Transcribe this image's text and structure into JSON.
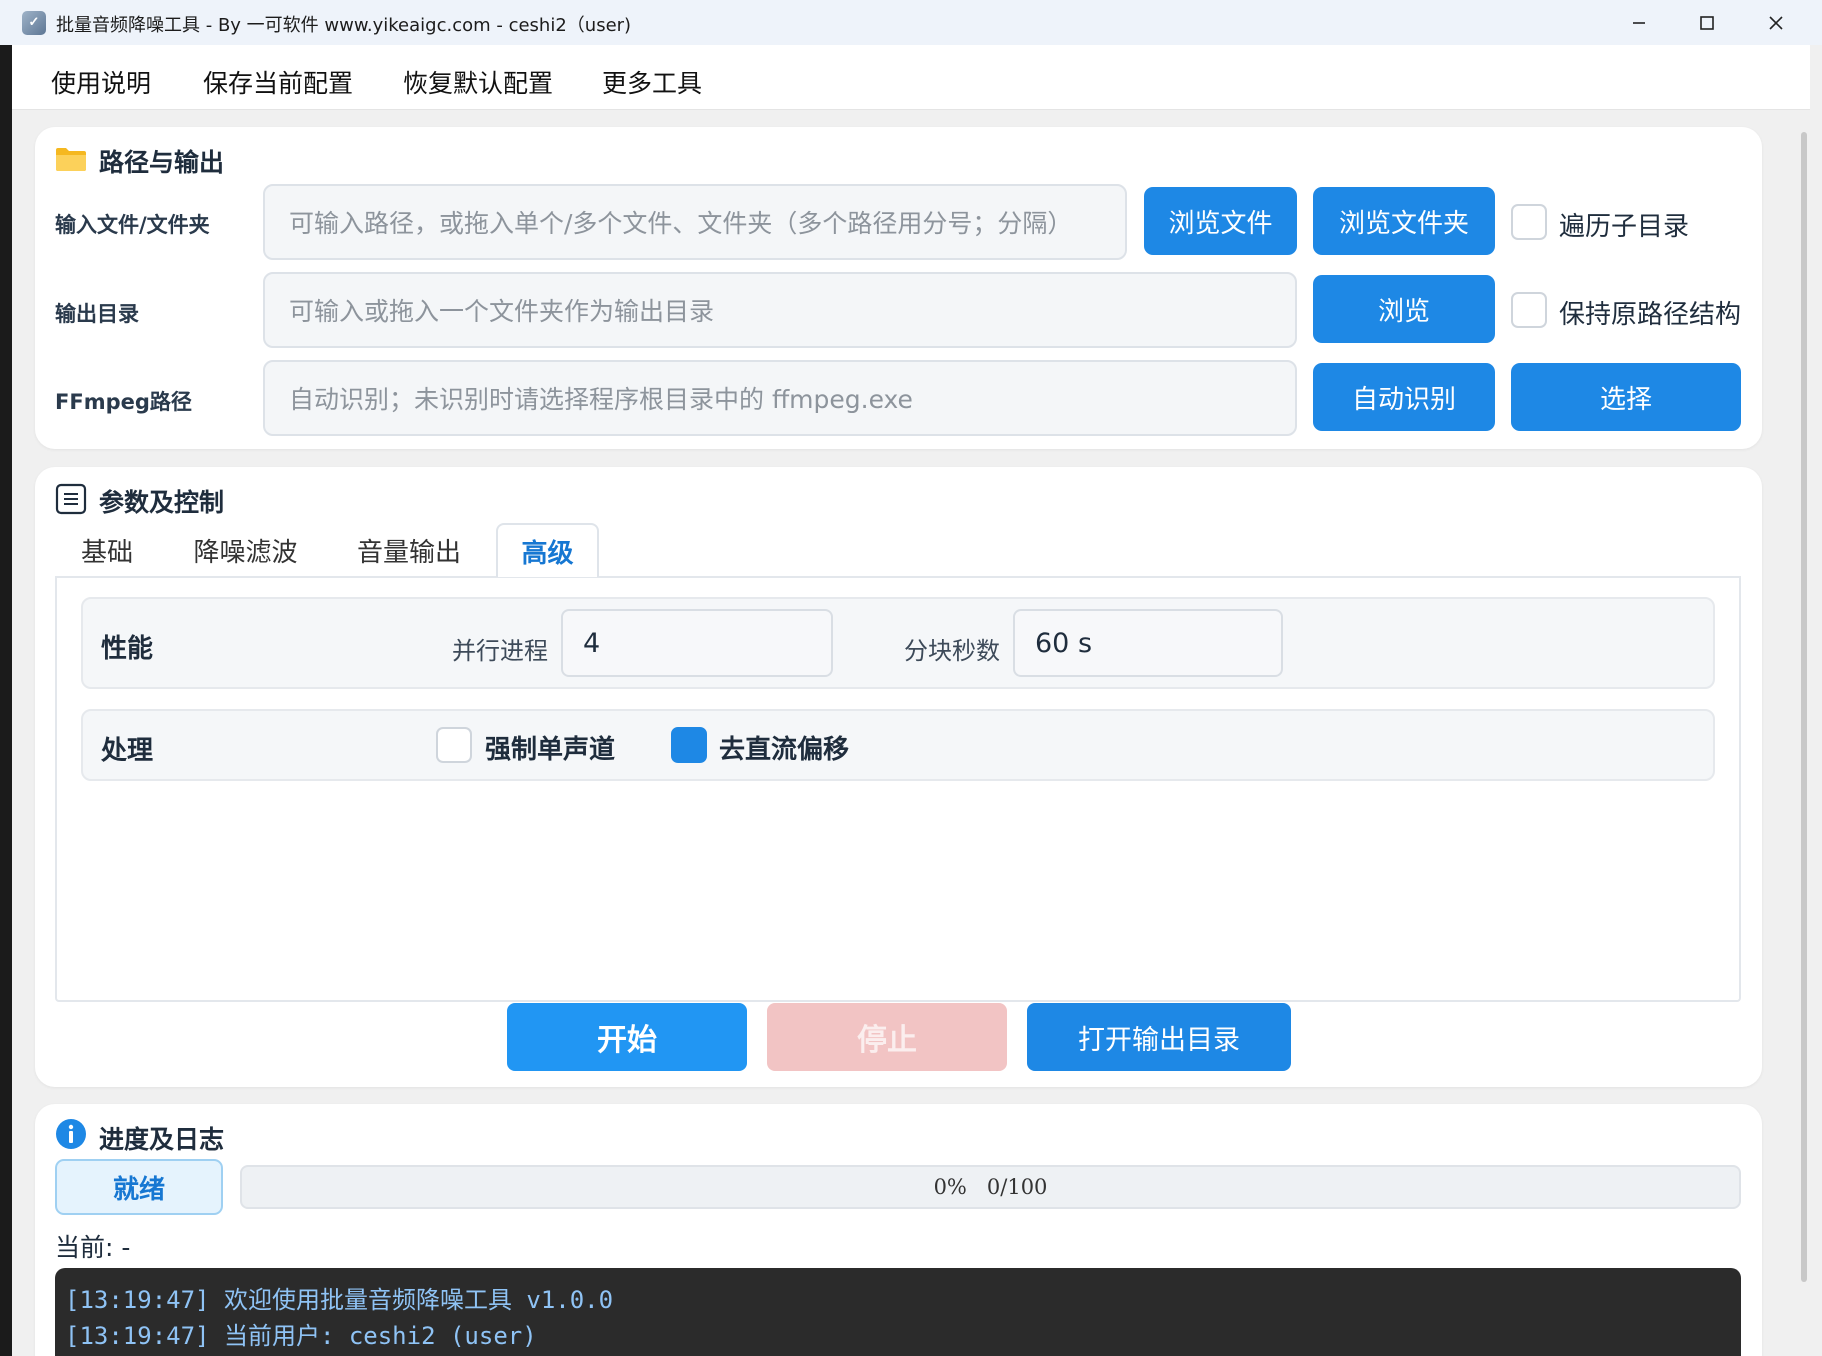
{
  "window": {
    "title": "批量音频降噪工具 - By 一可软件 www.yikeaigc.com - ceshi2（user)",
    "app_icon": "app-icon",
    "controls": {
      "minimize": "—",
      "maximize": "☐",
      "close": "✕"
    }
  },
  "menu": {
    "items": [
      "使用说明",
      "保存当前配置",
      "恢复默认配置",
      "更多工具"
    ]
  },
  "path_section": {
    "title": "路径与输出",
    "icon": "folder-icon",
    "input": {
      "label": "输入文件/文件夹",
      "placeholder": "可输入路径，或拖入单个/多个文件、文件夹（多个路径用分号；分隔）",
      "browse_files": "浏览文件",
      "browse_folder": "浏览文件夹",
      "recurse_label": "遍历子目录",
      "recurse_checked": false
    },
    "output": {
      "label": "输出目录",
      "placeholder": "可输入或拖入一个文件夹作为输出目录",
      "browse": "浏览",
      "keep_structure_label": "保持原路径结构",
      "keep_structure_checked": false
    },
    "ffmpeg": {
      "label": "FFmpeg路径",
      "placeholder": "自动识别；未识别时请选择程序根目录中的 ffmpeg.exe",
      "auto_detect": "自动识别",
      "select": "选择"
    }
  },
  "params_section": {
    "title": "参数及控制",
    "icon": "list-icon",
    "tabs": [
      {
        "label": "基础",
        "active": false
      },
      {
        "label": "降噪滤波",
        "active": false
      },
      {
        "label": "音量输出",
        "active": false
      },
      {
        "label": "高级",
        "active": true
      }
    ],
    "performance": {
      "title": "性能",
      "parallel_label": "并行进程",
      "parallel_value": "4",
      "chunk_label": "分块秒数",
      "chunk_value": "60 s"
    },
    "processing": {
      "title": "处理",
      "force_mono_label": "强制单声道",
      "force_mono_checked": false,
      "dc_offset_label": "去直流偏移",
      "dc_offset_checked": true
    },
    "actions": {
      "start": "开始",
      "stop": "停止",
      "open_output": "打开输出目录"
    },
    "colors": {
      "primary": "#1e88e5",
      "start": "#2196f3",
      "stop_disabled": "#f2c4c4"
    }
  },
  "progress_section": {
    "title": "进度及日志",
    "icon": "info-icon",
    "status": "就绪",
    "progress_percent": 0,
    "progress_text": "0%   0/100",
    "current": "当前: -",
    "log": [
      "[13:19:47] 欢迎使用批量音频降噪工具 v1.0.0",
      "[13:19:47] 当前用户: ceshi2 (user)"
    ]
  }
}
